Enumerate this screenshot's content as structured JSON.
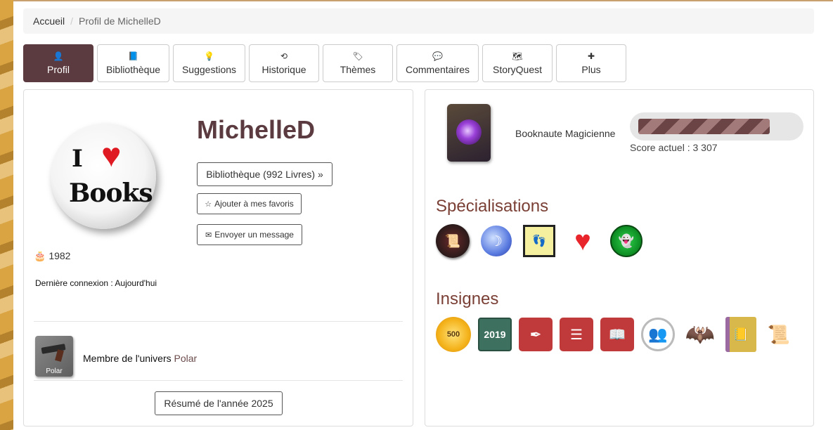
{
  "breadcrumb": {
    "home": "Accueil",
    "separator": "/",
    "current": "Profil de MichelleD"
  },
  "tabs": [
    {
      "icon": "user-icon",
      "glyph": "👤",
      "label": "Profil",
      "active": true
    },
    {
      "icon": "book-icon",
      "glyph": "📘",
      "label": "Bibliothèque",
      "active": false
    },
    {
      "icon": "lightbulb-icon",
      "glyph": "💡",
      "label": "Suggestions",
      "active": false
    },
    {
      "icon": "history-icon",
      "glyph": "⟲",
      "label": "Historique",
      "active": false
    },
    {
      "icon": "tags-icon",
      "glyph": "🏷",
      "label": "Thèmes",
      "active": false
    },
    {
      "icon": "comment-icon",
      "glyph": "💬",
      "label": "Commentaires",
      "active": false
    },
    {
      "icon": "map-icon",
      "glyph": "🗺",
      "label": "StoryQuest",
      "active": false
    },
    {
      "icon": "plus-icon",
      "glyph": "✚",
      "label": "Plus",
      "active": false
    }
  ],
  "profile": {
    "username": "MichelleD",
    "avatar_text": {
      "top": "I",
      "heart": "♥",
      "bottom": "Books"
    },
    "library_button": "Bibliothèque (992 Livres) »",
    "favorite_button": "Ajouter à mes favoris",
    "message_button": "Envoyer un message",
    "birth_year": "1982",
    "last_login": "Dernière connexion : Aujourd'hui",
    "universe_badge": "Polar",
    "member_prefix": "Membre de l'univers ",
    "member_universe": "Polar",
    "year_summary_button": "Résumé de l'année 2025"
  },
  "rank": {
    "name": "Booknaute Magicienne",
    "progress_fraction": 0.84,
    "score": "Score actuel : 3 307"
  },
  "specialisations": {
    "title": "Spécialisations",
    "items": [
      {
        "name": "scroll-badge-icon",
        "glyph": "📜"
      },
      {
        "name": "moon-badge-icon",
        "glyph": "☽"
      },
      {
        "name": "footprints-badge-icon",
        "glyph": "👣"
      },
      {
        "name": "heart-badge-icon",
        "glyph": "♥"
      },
      {
        "name": "ghost-badge-icon",
        "glyph": "👻"
      }
    ]
  },
  "insignes": {
    "title": "Insignes",
    "items": [
      {
        "name": "sun-500-badge-icon",
        "glyph": "500"
      },
      {
        "name": "hourglass-2019-badge-icon",
        "glyph": "2019"
      },
      {
        "name": "pen-badge-icon",
        "glyph": "✒"
      },
      {
        "name": "list-stars-badge-icon",
        "glyph": "☰"
      },
      {
        "name": "book-check-badge-icon",
        "glyph": "📖"
      },
      {
        "name": "group-badge-icon",
        "glyph": "👥"
      },
      {
        "name": "bat-web-badge-icon",
        "glyph": "🦇"
      },
      {
        "name": "book-bookmark-badge-icon",
        "glyph": "📒"
      },
      {
        "name": "scroll-roll-badge-icon",
        "glyph": "📜"
      }
    ]
  },
  "colors": {
    "accent": "#5b3b3f",
    "section_title": "#7a3f35",
    "heart": "#e01a22"
  }
}
